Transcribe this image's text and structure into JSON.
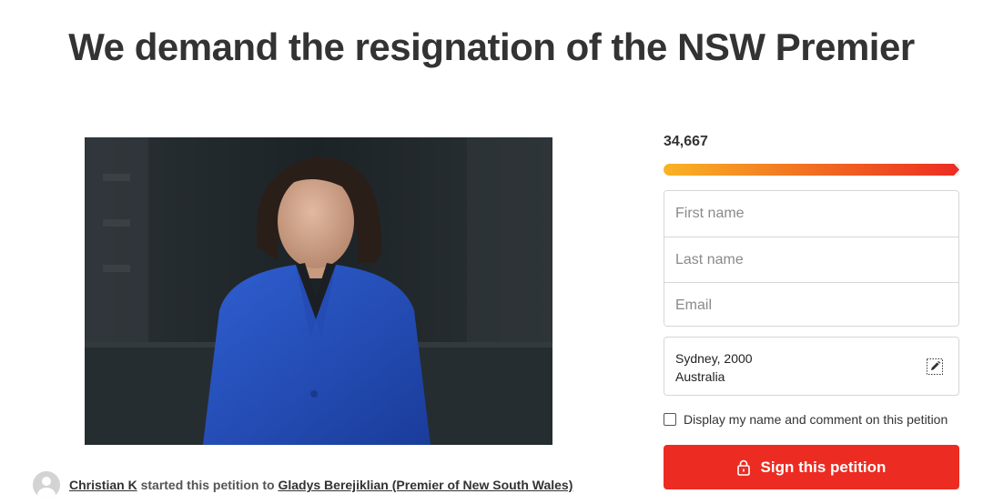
{
  "petition": {
    "title": "We demand the resignation of the NSW Premier",
    "starter_name": "Christian K",
    "started_text": "started this petition to",
    "target": "Gladys Berejiklian (Premier of New South Wales)"
  },
  "signatures": {
    "count": "34,667",
    "progress_fraction": 1.0
  },
  "form": {
    "first_name_placeholder": "First name",
    "last_name_placeholder": "Last name",
    "email_placeholder": "Email",
    "location_line1": "Sydney, 2000",
    "location_line2": "Australia",
    "display_checkbox_label": "Display my name and comment on this petition",
    "display_checkbox_checked": false,
    "sign_button_label": "Sign this petition"
  },
  "icons": {
    "lock": "lock-icon",
    "edit": "pencil-edit-icon",
    "avatar": "user-avatar-icon"
  },
  "colors": {
    "primary": "#ec2c22",
    "progress_start": "#f9b324",
    "progress_end": "#ec2c22",
    "text": "#333333"
  }
}
